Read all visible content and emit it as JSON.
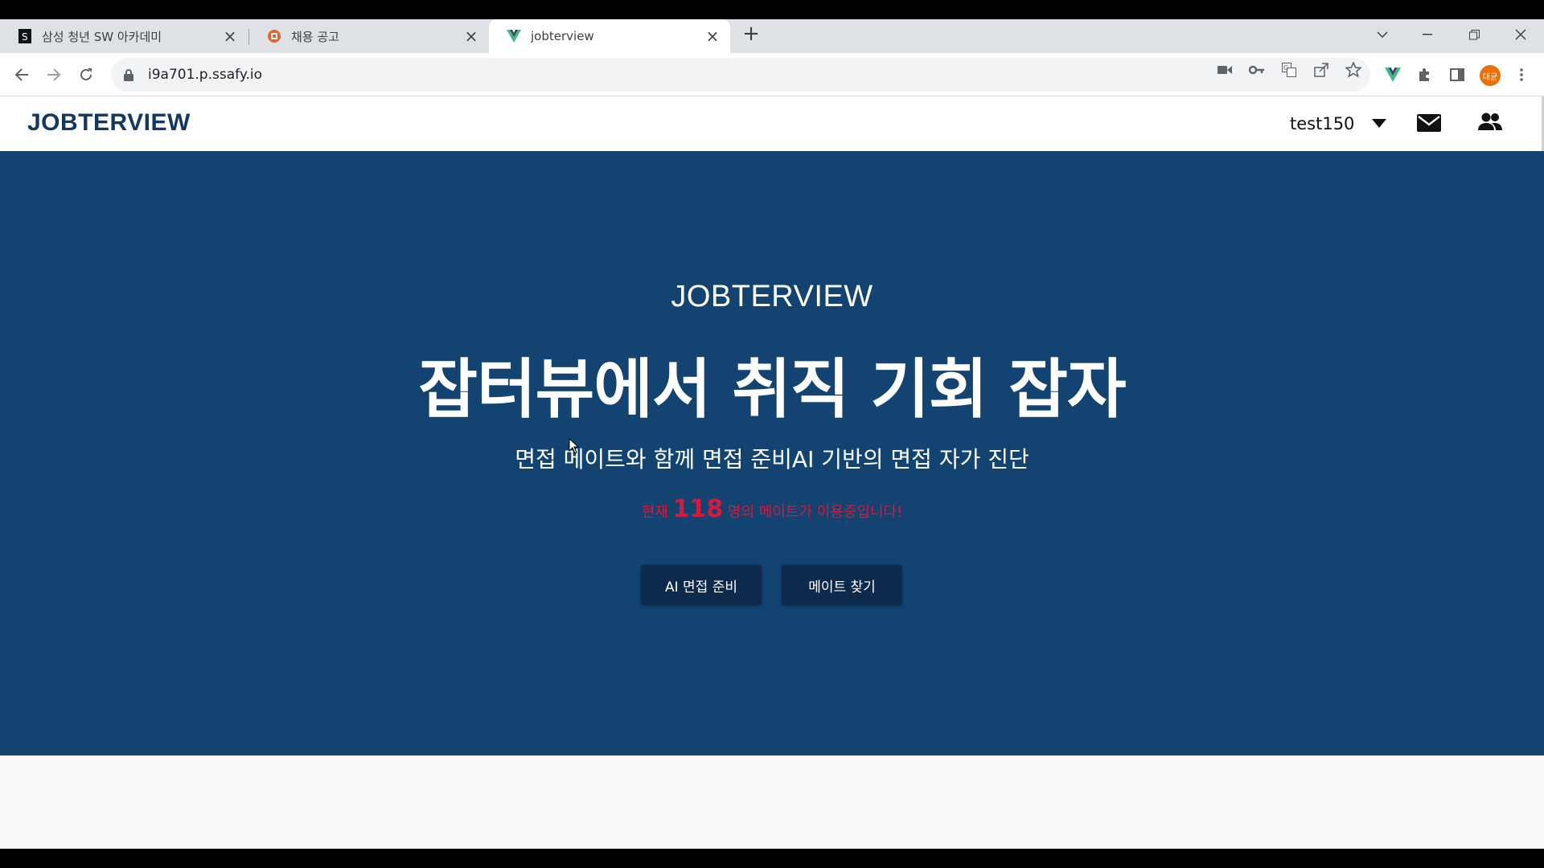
{
  "browser": {
    "tabs": [
      {
        "title": "삼성 청년 SW 아카데미",
        "favicon": "ssafy-favicon",
        "active": false
      },
      {
        "title": "채용 공고",
        "favicon": "job-posting-favicon",
        "active": false
      },
      {
        "title": "jobterview",
        "favicon": "vue-favicon",
        "active": true
      }
    ],
    "new_tab": "+",
    "url": "i9a701.p.ssafy.io",
    "profile_initials": "대균",
    "colors": {
      "tabstrip": "#dee1e6",
      "profile": "#e8710a"
    }
  },
  "site": {
    "brand": "JOBTERVIEW",
    "user": "test150",
    "icons": [
      "chevron-down-icon",
      "mail-icon",
      "users-icon"
    ]
  },
  "hero": {
    "eyebrow": "JOBTERVIEW",
    "title": "잡터뷰에서 취직 기회 잡자",
    "subtitle": "면접 메이트와 함께 면접 준비AI 기반의 면접 자가 진단",
    "count_prefix": "현재",
    "count_value": "118",
    "count_suffix": "명의 메이트가 이용중입니다!",
    "buttons": {
      "ai_interview": "AI 면접 준비",
      "find_mate": "메이트 찾기"
    },
    "colors": {
      "background": "#134471",
      "button": "#0d2a4d",
      "accent": "#d6193c"
    }
  }
}
